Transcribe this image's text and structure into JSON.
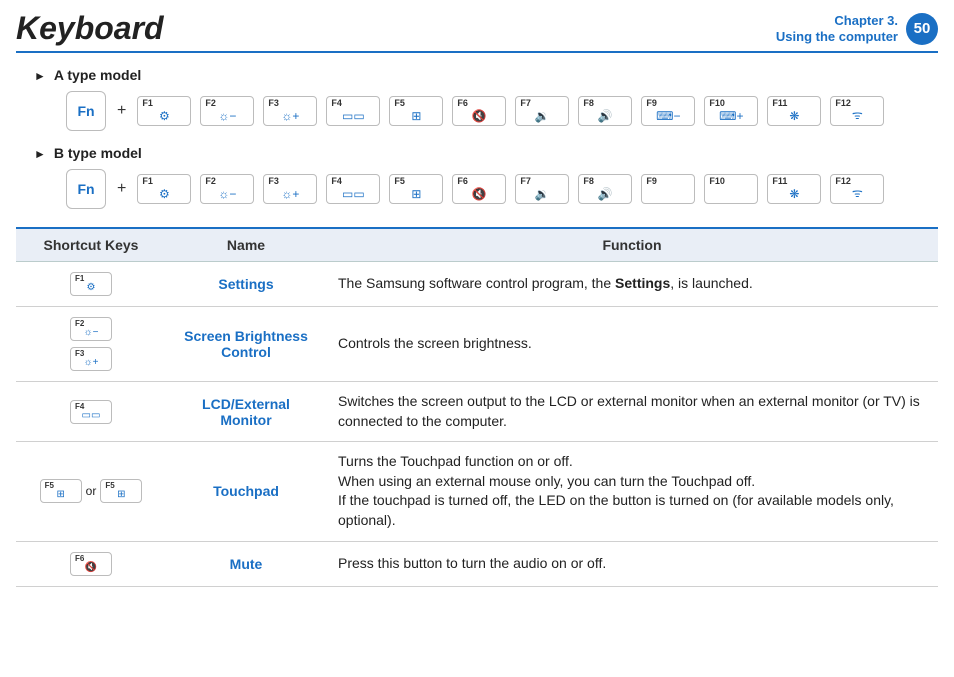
{
  "header": {
    "title": "Keyboard",
    "chapter_line1": "Chapter 3.",
    "chapter_line2": "Using the computer",
    "page": "50"
  },
  "models": {
    "a_label": "A type model",
    "b_label": "B type model",
    "fn": "Fn",
    "plus": "+",
    "keys_a": [
      {
        "n": "F1",
        "i": "⚙"
      },
      {
        "n": "F2",
        "i": "☼−"
      },
      {
        "n": "F3",
        "i": "☼+"
      },
      {
        "n": "F4",
        "i": "▭▭"
      },
      {
        "n": "F5",
        "i": "⊞"
      },
      {
        "n": "F6",
        "i": "🔇"
      },
      {
        "n": "F7",
        "i": "🔉"
      },
      {
        "n": "F8",
        "i": "🔊"
      },
      {
        "n": "F9",
        "i": "⌨−"
      },
      {
        "n": "F10",
        "i": "⌨+"
      },
      {
        "n": "F11",
        "i": "❋"
      },
      {
        "n": "F12",
        "i": "ᯤ"
      }
    ],
    "keys_b": [
      {
        "n": "F1",
        "i": "⚙"
      },
      {
        "n": "F2",
        "i": "☼−"
      },
      {
        "n": "F3",
        "i": "☼+"
      },
      {
        "n": "F4",
        "i": "▭▭"
      },
      {
        "n": "F5",
        "i": "⊞"
      },
      {
        "n": "F6",
        "i": "🔇"
      },
      {
        "n": "F7",
        "i": "🔉"
      },
      {
        "n": "F8",
        "i": "🔊"
      },
      {
        "n": "F9",
        "i": ""
      },
      {
        "n": "F10",
        "i": ""
      },
      {
        "n": "F11",
        "i": "❋"
      },
      {
        "n": "F12",
        "i": "ᯤ"
      }
    ]
  },
  "table": {
    "headers": {
      "shortcut": "Shortcut Keys",
      "name": "Name",
      "function": "Function"
    },
    "rows": [
      {
        "keys": [
          {
            "n": "F1",
            "i": "⚙"
          }
        ],
        "name": "Settings",
        "func_pre": "The Samsung software control program, the ",
        "func_bold": "Settings",
        "func_post": ", is launched."
      },
      {
        "keys": [
          {
            "n": "F2",
            "i": "☼−"
          },
          {
            "n": "F3",
            "i": "☼+"
          }
        ],
        "stack": true,
        "name": "Screen Brightness Control",
        "func": "Controls the screen brightness."
      },
      {
        "keys": [
          {
            "n": "F4",
            "i": "▭▭"
          }
        ],
        "name": "LCD/External Monitor",
        "func": "Switches the screen output to the LCD or external monitor when an external monitor (or TV) is connected to the computer."
      },
      {
        "keys_or": [
          {
            "n": "F5",
            "i": "⊞"
          },
          {
            "n": "F5",
            "i": "⊞"
          }
        ],
        "or": "or",
        "name": "Touchpad",
        "func_lines": [
          "Turns the Touchpad function on or off.",
          "When using an external mouse only, you can turn the Touchpad off.",
          "If the touchpad is turned off, the LED on the button is turned on (for available models only, optional)."
        ]
      },
      {
        "keys": [
          {
            "n": "F6",
            "i": "🔇"
          }
        ],
        "name": "Mute",
        "func": "Press this button to turn the audio on or off."
      }
    ]
  }
}
